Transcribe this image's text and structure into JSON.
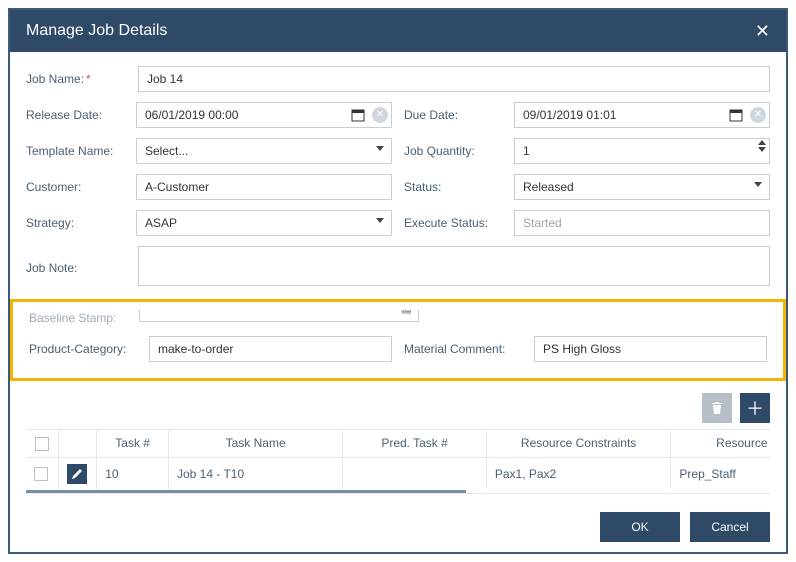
{
  "dialog": {
    "title": "Manage Job Details"
  },
  "labels": {
    "jobName": "Job Name:",
    "releaseDate": "Release Date:",
    "dueDate": "Due Date:",
    "templateName": "Template Name:",
    "jobQuantity": "Job Quantity:",
    "customer": "Customer:",
    "status": "Status:",
    "strategy": "Strategy:",
    "execStatus": "Execute Status:",
    "jobNote": "Job Note:",
    "baseline": "Baseline Stamp:",
    "productCategory": "Product-Category:",
    "materialComment": "Material Comment:"
  },
  "values": {
    "jobName": "Job 14",
    "releaseDate": "06/01/2019 00:00",
    "dueDate": "09/01/2019 01:01",
    "templateName": "Select...",
    "jobQuantity": "1",
    "customer": "A-Customer",
    "status": "Released",
    "strategy": "ASAP",
    "execStatus": "Started",
    "jobNote": "",
    "productCategory": "make-to-order",
    "materialComment": "PS High Gloss"
  },
  "columns": {
    "taskNum": "Task #",
    "taskName": "Task Name",
    "predTask": "Pred. Task #",
    "resConstraints": "Resource Constraints",
    "resGroups": "Resource Groups"
  },
  "rows": [
    {
      "taskNum": "10",
      "taskName": "Job 14 - T10",
      "predTask": "",
      "resConstraints": "Pax1, Pax2",
      "resGroups": "Prep_Staff"
    }
  ],
  "buttons": {
    "ok": "OK",
    "cancel": "Cancel"
  }
}
